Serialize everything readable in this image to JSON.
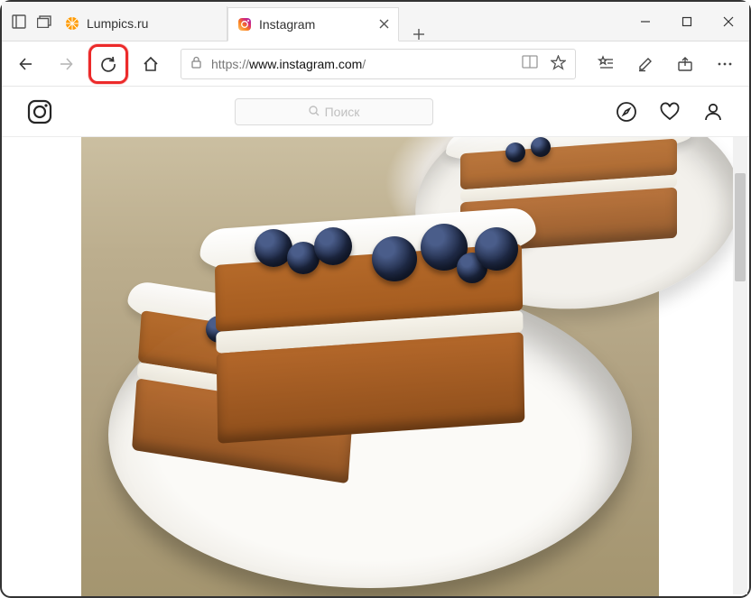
{
  "tabs": [
    {
      "title": "Lumpics.ru",
      "active": false
    },
    {
      "title": "Instagram",
      "active": true
    }
  ],
  "address_bar": {
    "protocol": "https://",
    "domain": "www.instagram.com",
    "path": "/"
  },
  "instagram": {
    "search_placeholder": "Поиск"
  }
}
